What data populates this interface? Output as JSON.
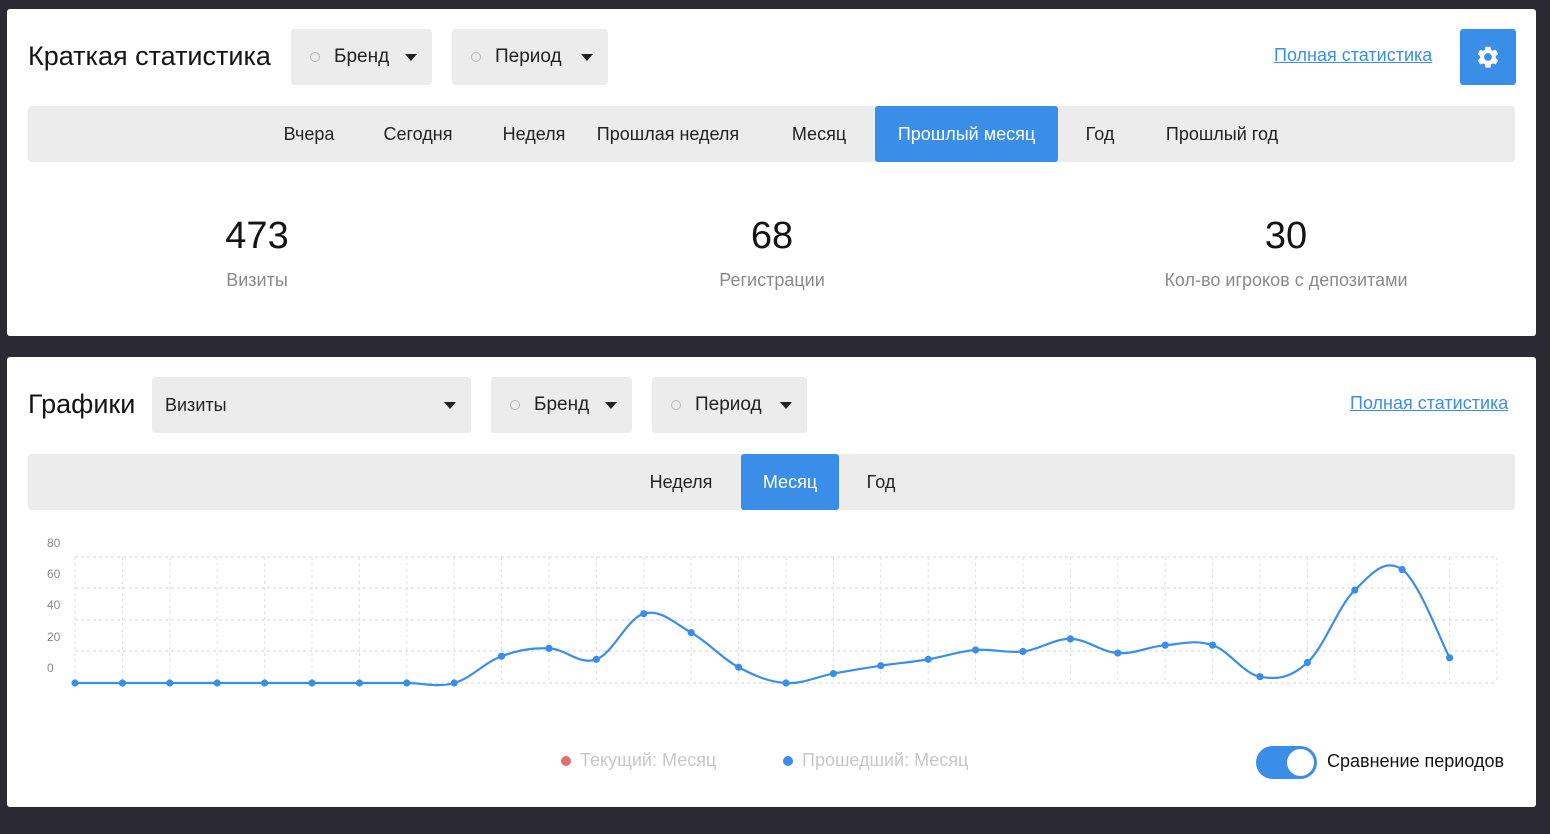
{
  "summary": {
    "title": "Краткая статистика",
    "brand_label": "Бренд",
    "period_label": "Период",
    "full_stats_link": "Полная статистика",
    "tabs": [
      "Вчера",
      "Сегодня",
      "Неделя",
      "Прошлая неделя",
      "Месяц",
      "Прошлый месяц",
      "Год",
      "Прошлый год"
    ],
    "active_tab": "Прошлый месяц",
    "stats": [
      {
        "value": "473",
        "label": "Визиты"
      },
      {
        "value": "68",
        "label": "Регистрации"
      },
      {
        "value": "30",
        "label": "Кол-во игроков с депозитами"
      }
    ]
  },
  "charts": {
    "title": "Графики",
    "metric_value": "Визиты",
    "brand_label": "Бренд",
    "period_label": "Период",
    "full_stats_link": "Полная статистика",
    "tabs": [
      "Неделя",
      "Месяц",
      "Год"
    ],
    "active_tab": "Месяц",
    "legend": {
      "current": "Текущий: Месяц",
      "previous": "Прошедший: Месяц"
    },
    "compare_label": "Сравнение периодов",
    "compare_enabled": true
  },
  "colors": {
    "accent": "#3b8ee8",
    "current_series": "#e07070",
    "previous_series": "#3b8ee8"
  },
  "chart_data": {
    "type": "line",
    "y_ticks": [
      "80",
      "60",
      "40",
      "20",
      "0"
    ],
    "ylim": [
      0,
      80
    ],
    "grid": true,
    "legend_position": "bottom",
    "series": [
      {
        "name": "Прошедший: Месяц",
        "values": [
          0,
          0,
          0,
          0,
          0,
          0,
          0,
          0,
          0,
          17,
          22,
          15,
          44,
          32,
          10,
          0,
          6,
          11,
          15,
          21,
          20,
          28,
          19,
          24,
          24,
          4,
          13,
          59,
          72,
          16
        ]
      }
    ]
  }
}
